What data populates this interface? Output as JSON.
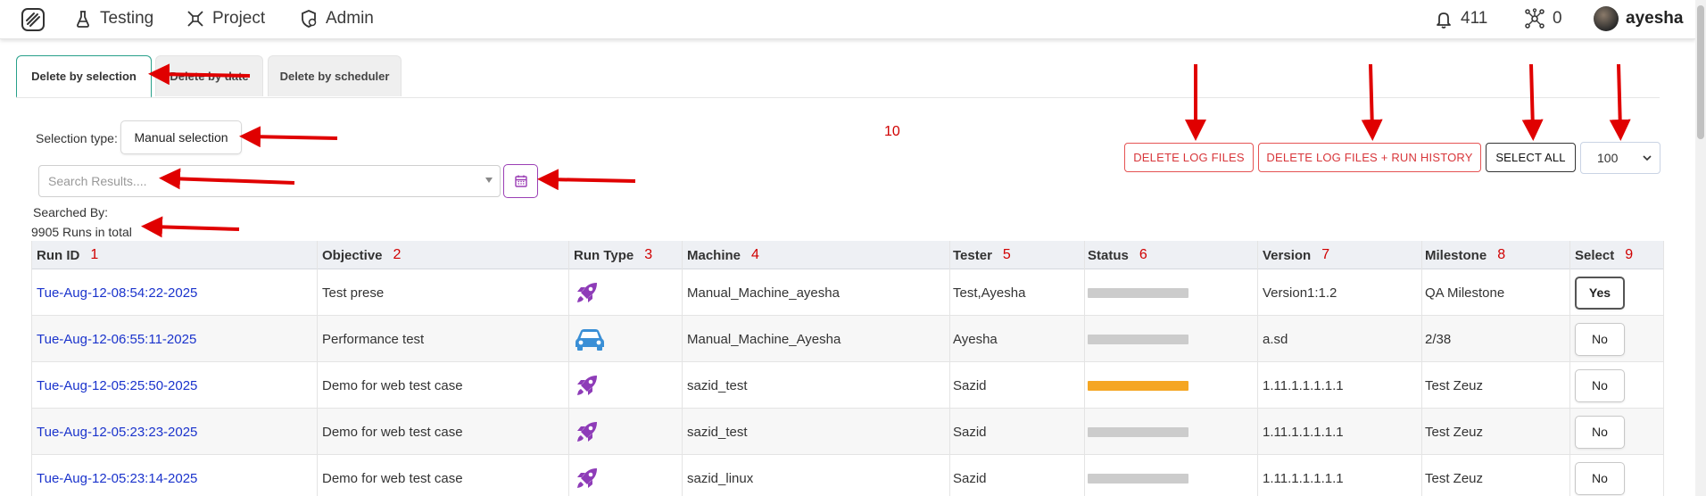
{
  "nav": {
    "items": [
      {
        "label": "Testing",
        "icon": "flask-icon"
      },
      {
        "label": "Project",
        "icon": "project-icon"
      },
      {
        "label": "Admin",
        "icon": "admin-shield-icon"
      }
    ],
    "notifications_count": "411",
    "network_count": "0",
    "user_name": "ayesha"
  },
  "tabs": [
    {
      "label": "Delete by selection",
      "active": true
    },
    {
      "label": "Delete by date",
      "active": false
    },
    {
      "label": "Delete by scheduler",
      "active": false
    }
  ],
  "selection": {
    "label": "Selection type:",
    "value": "Manual selection"
  },
  "search": {
    "placeholder": "Search Results...."
  },
  "summary": {
    "searched_by": "Searched By:",
    "total": "9905 Runs in total"
  },
  "annotation_number": "10",
  "actions": {
    "delete_logs": "DELETE LOG FILES",
    "delete_logs_history": "DELETE LOG FILES + RUN HISTORY",
    "select_all": "SELECT ALL",
    "page_size": "100"
  },
  "table": {
    "headers": [
      {
        "label": "Run ID",
        "num": "1"
      },
      {
        "label": "Objective",
        "num": "2"
      },
      {
        "label": "Run Type",
        "num": "3"
      },
      {
        "label": "Machine",
        "num": "4"
      },
      {
        "label": "Tester",
        "num": "5"
      },
      {
        "label": "Status",
        "num": "6"
      },
      {
        "label": "Version",
        "num": "7"
      },
      {
        "label": "Milestone",
        "num": "8"
      },
      {
        "label": "Select",
        "num": "9"
      }
    ],
    "rows": [
      {
        "run_id": "Tue-Aug-12-08:54:22-2025",
        "objective": "Test prese",
        "run_type": "rocket-icon",
        "machine": "Manual_Machine_ayesha",
        "tester": "Test,Ayesha",
        "status_color": "#cccccc",
        "version": "Version1:1.2",
        "milestone": "QA Milestone",
        "select": "Yes"
      },
      {
        "run_id": "Tue-Aug-12-06:55:11-2025",
        "objective": "Performance test",
        "run_type": "car-icon",
        "machine": "Manual_Machine_Ayesha",
        "tester": "Ayesha",
        "status_color": "#cccccc",
        "version": "a.sd",
        "milestone": "2/38",
        "select": "No"
      },
      {
        "run_id": "Tue-Aug-12-05:25:50-2025",
        "objective": "Demo for web test case",
        "run_type": "rocket-icon",
        "machine": "sazid_test",
        "tester": "Sazid",
        "status_color": "#f5a623",
        "version": "1.11.1.1.1.1.1",
        "milestone": "Test Zeuz",
        "select": "No"
      },
      {
        "run_id": "Tue-Aug-12-05:23:23-2025",
        "objective": "Demo for web test case",
        "run_type": "rocket-icon",
        "machine": "sazid_test",
        "tester": "Sazid",
        "status_color": "#cccccc",
        "version": "1.11.1.1.1.1.1",
        "milestone": "Test Zeuz",
        "select": "No"
      },
      {
        "run_id": "Tue-Aug-12-05:23:14-2025",
        "objective": "Demo for web test case",
        "run_type": "rocket-icon",
        "machine": "sazid_linux",
        "tester": "Sazid",
        "status_color": "#cccccc",
        "version": "1.11.1.1.1.1.1",
        "milestone": "Test Zeuz",
        "select": "No"
      }
    ]
  },
  "colors": {
    "accent_tab": "#28a08a",
    "danger": "#d8363a",
    "link": "#1a33cc",
    "annotation": "#d00000",
    "run_type_purple": "#8e3cb8",
    "run_type_blue": "#3a8fd6"
  }
}
